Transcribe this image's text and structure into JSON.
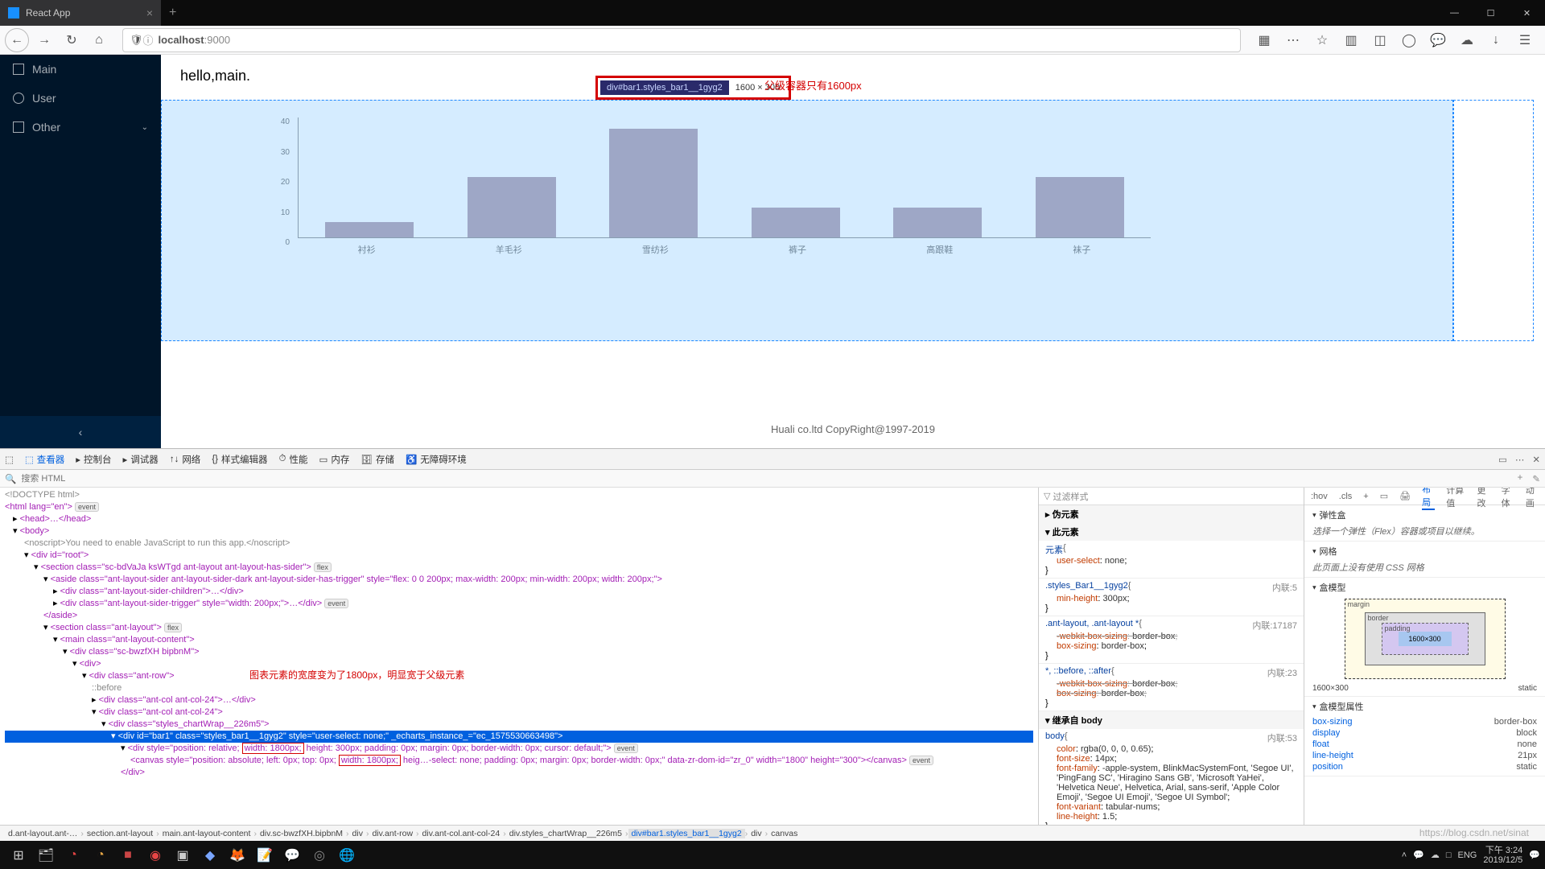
{
  "browser": {
    "tab_title": "React App",
    "url_display": "localhost:9000",
    "url_host": "localhost",
    "url_port": ":9000"
  },
  "sidebar": {
    "items": [
      {
        "label": "Main",
        "icon": "home"
      },
      {
        "label": "User",
        "icon": "user"
      },
      {
        "label": "Other",
        "icon": "display",
        "chevron": true
      }
    ]
  },
  "page": {
    "heading": "hello,main.",
    "footer": "Huali co.ltd CopyRight@1997-2019",
    "tooltip_selector": "div#bar1.styles_bar1__1gyg2",
    "tooltip_dims": "1600 × 300",
    "note_parent": "父级容器只有1600px",
    "note_chart": "图表元素的宽度变为了1800px，明显宽于父级元素"
  },
  "chart_data": {
    "type": "bar",
    "categories": [
      "衬衫",
      "羊毛衫",
      "雪纺衫",
      "裤子",
      "高跟鞋",
      "袜子"
    ],
    "values": [
      5,
      20,
      36,
      10,
      10,
      20
    ],
    "ylim": [
      0,
      40
    ],
    "yticks": [
      0,
      10,
      20,
      30,
      40
    ]
  },
  "devtools": {
    "tabs": [
      "查看器",
      "控制台",
      "调试器",
      "网络",
      "样式编辑器",
      "性能",
      "内存",
      "存储",
      "无障碍环境"
    ],
    "search_placeholder": "搜索 HTML",
    "styles_filter": "过滤样式",
    "styles_right_tabs": [
      ":hov",
      ".cls",
      "+"
    ],
    "pseudo_head": "伪元素",
    "this_el": "此元素",
    "inherit_body": "继承自 body",
    "rules": [
      {
        "sel": "元素",
        "src": "",
        "props": [
          {
            "k": "user-select",
            "v": "none"
          }
        ]
      },
      {
        "sel": ".styles_Bar1__1gyg2",
        "src": "内联:5",
        "props": [
          {
            "k": "min-height",
            "v": "300px"
          }
        ]
      },
      {
        "sel": ".ant-layout, .ant-layout *",
        "src": "内联:17187",
        "props": [
          {
            "k": "-webkit-box-sizing",
            "v": "border-box",
            "strike": true
          },
          {
            "k": "box-sizing",
            "v": "border-box"
          }
        ]
      },
      {
        "sel": "*, ::before, ::after",
        "src": "内联:23",
        "props": [
          {
            "k": "-webkit-box-sizing",
            "v": "border-box",
            "strike": true
          },
          {
            "k": "box-sizing",
            "v": "border-box",
            "strike": true
          }
        ]
      },
      {
        "sel": "body",
        "src": "内联:53",
        "props": [
          {
            "k": "color",
            "v": "rgba(0, 0, 0, 0.65)"
          },
          {
            "k": "font-size",
            "v": "14px"
          },
          {
            "k": "font-family",
            "v": "-apple-system, BlinkMacSystemFont, 'Segoe UI', 'PingFang SC', 'Hiragino Sans GB', 'Microsoft YaHei', 'Helvetica Neue', Helvetica, Arial, sans-serif, 'Apple Color Emoji', 'Segoe UI Emoji', 'Segoe UI Symbol'"
          },
          {
            "k": "font-variant",
            "v": "tabular-nums"
          },
          {
            "k": "line-height",
            "v": "1.5"
          }
        ]
      }
    ],
    "layout_tabs": [
      "布局",
      "计算值",
      "更改",
      "字体",
      "动画"
    ],
    "flex_head": "弹性盒",
    "flex_hint": "选择一个弹性（Flex）容器或项目以继续。",
    "grid_head": "网格",
    "grid_hint": "此页面上没有使用 CSS 网格",
    "box_head": "盒模型",
    "box_dims": "1600×300",
    "box_position": "static",
    "box_props_head": "盒模型属性",
    "box_props": [
      {
        "k": "box-sizing",
        "v": "border-box"
      },
      {
        "k": "display",
        "v": "block"
      },
      {
        "k": "float",
        "v": "none"
      },
      {
        "k": "line-height",
        "v": "21px"
      },
      {
        "k": "position",
        "v": "static"
      }
    ],
    "breadcrumb": [
      "d.ant-layout.ant-…",
      "section.ant-layout",
      "main.ant-layout-content",
      "div.sc-bwzfXH.bipbnM",
      "div",
      "div.ant-row",
      "div.ant-col.ant-col-24",
      "div.styles_chartWrap__226m5",
      "div#bar1.styles_bar1__1gyg2",
      "div",
      "canvas"
    ],
    "dom": {
      "doctype": "<!DOCTYPE html>",
      "html_open": "<html lang=\"en\">",
      "head_collapsed": "<head>…</head>",
      "body_open": "<body>",
      "noscript": "<noscript>You need to enable JavaScript to run this app.</noscript>",
      "root": "<div id=\"root\">",
      "section1": "<section class=\"sc-bdVaJa ksWTgd ant-layout ant-layout-has-sider\">",
      "aside": "<aside class=\"ant-layout-sider ant-layout-sider-dark ant-layout-sider-has-trigger\" style=\"flex: 0 0 200px; max-width: 200px; min-width: 200px; width: 200px;\">",
      "aside_children": "<div class=\"ant-layout-sider-children\">…</div>",
      "aside_trigger": "<div class=\"ant-layout-sider-trigger\" style=\"width: 200px;\">…</div>",
      "aside_close": "</aside>",
      "section2": "<section class=\"ant-layout\">",
      "main": "<main class=\"ant-layout-content\">",
      "sc": "<div class=\"sc-bwzfXH bipbnM\">",
      "div_open": "<div>",
      "antrow": "<div class=\"ant-row\">",
      "before": "::before",
      "col1": "<div class=\"ant-col ant-col-24\">…</div>",
      "col2": "<div class=\"ant-col ant-col-24\">",
      "chartwrap": "<div class=\"styles_chartWrap__226m5\">",
      "hl_line": "<div id=\"bar1\" class=\"styles_bar1__1gyg2\" style=\"user-select: none;\" _echarts_instance_=\"ec_1575530663498\">",
      "inner_div_pre": "<div style=\"position: relative;",
      "inner_div_w": "width: 1800px;",
      "inner_div_post": "height: 300px; padding: 0px; margin: 0px; border-width: 0px; cursor: default;\">",
      "canvas_pre": "<canvas style=\"position: absolute; left: 0px; top: 0px;",
      "canvas_w": "width: 1800px;",
      "canvas_post": "heig…-select: none; padding: 0px; margin: 0px; border-width: 0px;\" data-zr-dom-id=\"zr_0\" width=\"1800\" height=\"300\"></canvas>",
      "div_close": "</div>"
    }
  },
  "taskbar": {
    "time": "下午 3:24",
    "date": "2019/12/5",
    "watermark": "https://blog.csdn.net/sinat"
  }
}
